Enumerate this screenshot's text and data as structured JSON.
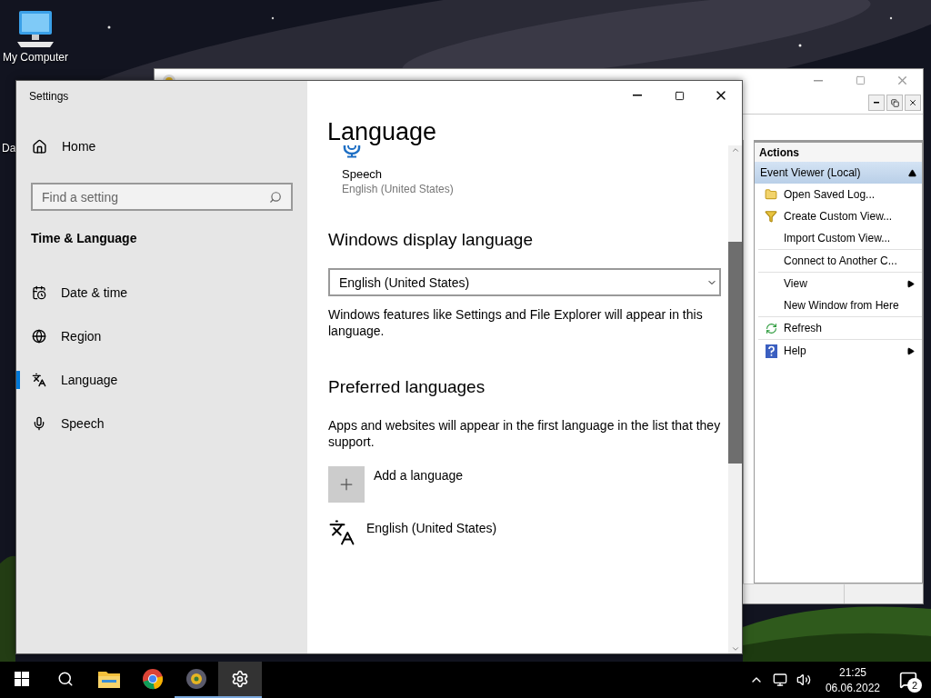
{
  "desktop": {
    "icons": [
      {
        "label": "My Computer",
        "kind": "computer"
      },
      {
        "label": "Da",
        "kind": "covered"
      }
    ]
  },
  "component_services": {
    "actions": {
      "title": "Actions",
      "group": {
        "label": "Event Viewer (Local)",
        "expanded": true
      },
      "items": [
        {
          "label": "Open Saved Log...",
          "kind": "folder",
          "submenu": false
        },
        {
          "label": "Create Custom View...",
          "kind": "filter",
          "submenu": false
        },
        {
          "label": "Import Custom View...",
          "kind": "plain",
          "submenu": false
        },
        {
          "kind": "separator"
        },
        {
          "label": "Connect to Another C...",
          "kind": "plain",
          "submenu": false
        },
        {
          "kind": "separator"
        },
        {
          "label": "View",
          "kind": "plain",
          "submenu": true
        },
        {
          "label": "New Window from Here",
          "kind": "plain",
          "submenu": false
        },
        {
          "kind": "separator"
        },
        {
          "label": "Refresh",
          "kind": "refresh",
          "submenu": false
        },
        {
          "kind": "separator"
        },
        {
          "label": "Help",
          "kind": "help",
          "submenu": true
        }
      ]
    }
  },
  "settings": {
    "title": "Settings",
    "home": "Home",
    "search": {
      "placeholder": "Find a setting"
    },
    "section": "Time & Language",
    "nav": [
      {
        "label": "Date & time",
        "kind": "clock",
        "selected": false
      },
      {
        "label": "Region",
        "kind": "globe",
        "selected": false
      },
      {
        "label": "Language",
        "kind": "language",
        "selected": true
      },
      {
        "label": "Speech",
        "kind": "mic",
        "selected": false
      }
    ],
    "page_title": "Language",
    "tile": {
      "label": "Speech",
      "sub": "English (United States)"
    },
    "display_language": {
      "heading": "Windows display language",
      "value": "English (United States)",
      "description": "Windows features like Settings and File Explorer will appear in this language."
    },
    "preferred": {
      "heading": "Preferred languages",
      "description": "Apps and websites will appear in the first language in the list that they support.",
      "add_label": "Add a language",
      "languages": [
        {
          "label": "English (United States)"
        }
      ]
    }
  },
  "taskbar": {
    "apps": [
      {
        "kind": "start",
        "running": false,
        "active": false
      },
      {
        "kind": "search",
        "running": false,
        "active": false
      },
      {
        "kind": "explorer",
        "running": false,
        "active": false
      },
      {
        "kind": "chrome",
        "running": false,
        "active": false
      },
      {
        "kind": "app",
        "running": true,
        "active": false
      },
      {
        "kind": "settings",
        "running": true,
        "active": true
      }
    ],
    "tray": {
      "time": "21:25",
      "date": "06.06.2022",
      "notifications": "2"
    }
  }
}
